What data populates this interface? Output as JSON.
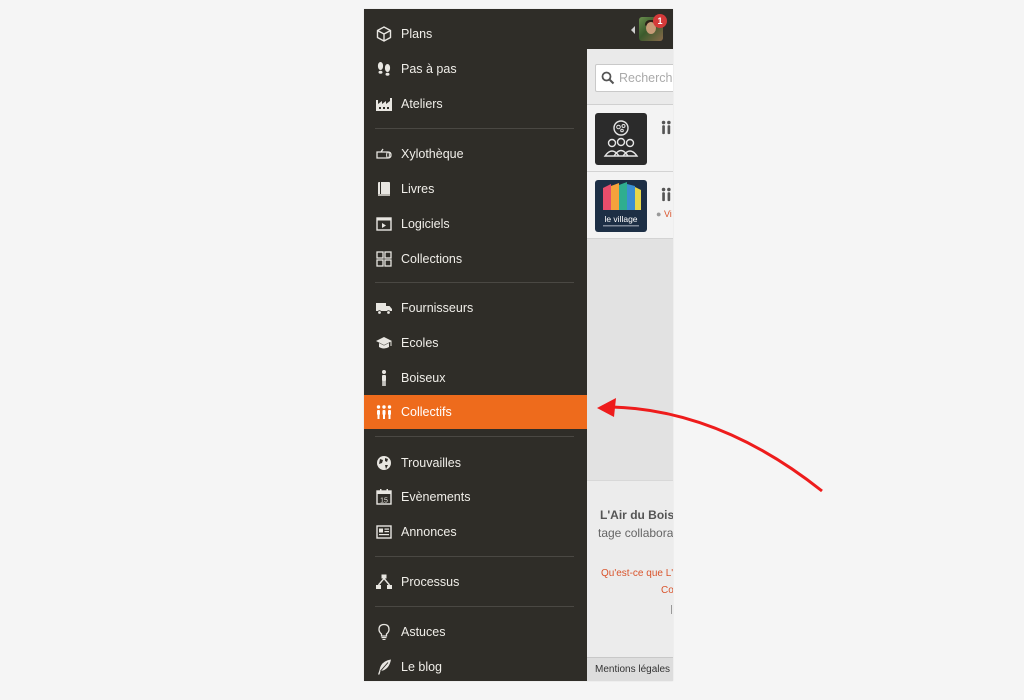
{
  "sidebar": {
    "items": [
      {
        "label": "Plans",
        "icon": "cube-icon"
      },
      {
        "label": "Pas à pas",
        "icon": "footsteps-icon"
      },
      {
        "label": "Ateliers",
        "icon": "factory-icon"
      },
      {
        "label": "Xylothèque",
        "icon": "wood-log-icon"
      },
      {
        "label": "Livres",
        "icon": "book-icon"
      },
      {
        "label": "Logiciels",
        "icon": "software-window-icon"
      },
      {
        "label": "Collections",
        "icon": "grid-icon"
      },
      {
        "label": "Fournisseurs",
        "icon": "truck-icon"
      },
      {
        "label": "Ecoles",
        "icon": "graduation-cap-icon"
      },
      {
        "label": "Boiseux",
        "icon": "person-icon"
      },
      {
        "label": "Collectifs",
        "icon": "group-icon",
        "active": true
      },
      {
        "label": "Trouvailles",
        "icon": "globe-icon"
      },
      {
        "label": "Evènements",
        "icon": "calendar-icon",
        "icon_text": "15"
      },
      {
        "label": "Annonces",
        "icon": "newspaper-icon"
      },
      {
        "label": "Processus",
        "icon": "flowchart-icon"
      },
      {
        "label": "Astuces",
        "icon": "lightbulb-icon"
      },
      {
        "label": "Le blog",
        "icon": "feather-icon"
      }
    ]
  },
  "header": {
    "notification_count": "1"
  },
  "search": {
    "placeholder": "Recherch"
  },
  "list": {
    "rows": [
      {
        "logo": "people-thought-logo"
      },
      {
        "logo": "le-village-logo",
        "logo_text": "le village",
        "location": "Vi"
      }
    ]
  },
  "footer": {
    "title": "L'Air du Bois",
    "subtitle": "tage collabora",
    "link1": "Qu'est-ce que L'",
    "link2": "Co",
    "legal": "Mentions légales"
  },
  "colors": {
    "sidebar_bg": "#2f2d28",
    "accent": "#ee6b1c",
    "arrow": "#ee1c1c"
  }
}
